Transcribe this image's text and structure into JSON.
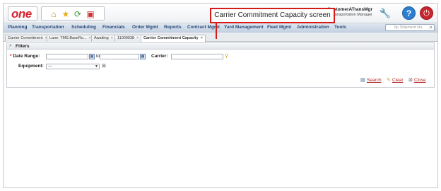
{
  "header": {
    "logo": "one",
    "user_name": "CustomerATransMgr",
    "user_role": "Transportation Manager"
  },
  "nav": {
    "items": [
      "Planning",
      "Transportation",
      "Scheduling",
      "Financials",
      "Order Mgmt",
      "Reports",
      "Contract Mgmt",
      "Yard Management",
      "Fleet Mgmt",
      "Administration",
      "Tools"
    ],
    "search_placeholder": "by Shipment No."
  },
  "tabs": [
    {
      "label": "Carrier Commitment",
      "active": false
    },
    {
      "label": "Lane: TMS.BaseRo...",
      "active": false
    },
    {
      "label": "Awaiting",
      "active": false
    },
    {
      "label": "11009938",
      "active": false
    },
    {
      "label": "Carrier Commitment Capacity",
      "active": true
    }
  ],
  "filters": {
    "title": "Filters",
    "date_range_label": "Date Range:",
    "to_label": "to",
    "carrier_label": "Carrier:",
    "equipment_label": "Equipment:",
    "equipment_value": "---",
    "search_label": "Search",
    "clear_label": "Clear",
    "close_label": "Close"
  },
  "callout": {
    "text": "Carrier Commitment Capacity screen"
  },
  "colors": {
    "brand_red": "#d3242d",
    "nav_text": "#2b4a77",
    "callout_border": "#d61a1a",
    "link_red": "#b22222"
  },
  "icons": [
    "home-icon",
    "star-icon",
    "refresh-icon",
    "monitor-icon",
    "wrench-icon",
    "help-icon",
    "power-icon",
    "search-icon",
    "calendar-icon",
    "lookup-icon",
    "clear-icon",
    "close-icon"
  ]
}
